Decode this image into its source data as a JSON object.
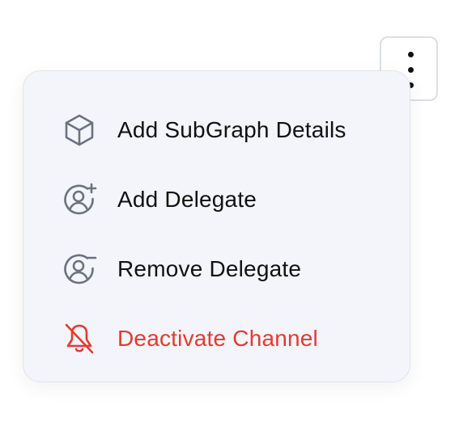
{
  "trigger": {
    "icon": "more-vertical-icon"
  },
  "menu": {
    "items": [
      {
        "label": "Add SubGraph Details",
        "icon": "cube-icon"
      },
      {
        "label": "Add Delegate",
        "icon": "user-add-icon"
      },
      {
        "label": "Remove Delegate",
        "icon": "user-remove-icon"
      },
      {
        "label": "Deactivate Channel",
        "icon": "bell-off-icon"
      }
    ]
  },
  "colors": {
    "menu_background": "#f4f5fa",
    "icon_gray": "#6b7280",
    "danger": "#e53a2f",
    "text": "#111111"
  }
}
